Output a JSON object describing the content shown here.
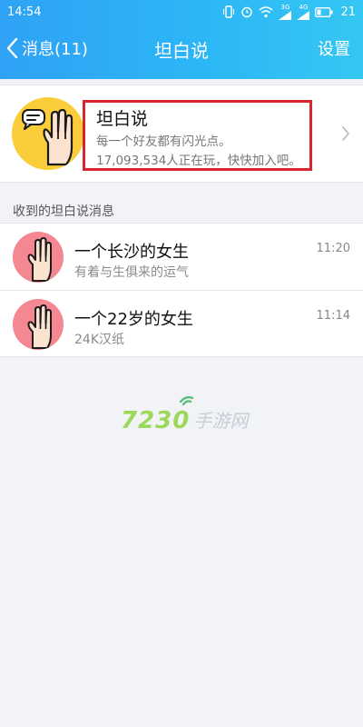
{
  "status_bar": {
    "time": "14:54",
    "battery": "21",
    "signal_labels": [
      "3G",
      "4G"
    ]
  },
  "nav": {
    "back_label": "消息(11)",
    "title": "坦白说",
    "settings_label": "设置"
  },
  "feature": {
    "title": "坦白说",
    "subtitle": "每一个好友都有闪光点。",
    "count_text": "17,093,534人正在玩，快快加入吧。"
  },
  "section": {
    "label": "收到的坦白说消息"
  },
  "messages": [
    {
      "title": "一个长沙的女生",
      "subtitle": "有着与生俱来的运气",
      "time": "11:20"
    },
    {
      "title": "一个22岁的女生",
      "subtitle": "24K汉纸",
      "time": "11:14"
    }
  ],
  "watermark": {
    "number": "7230",
    "text": "手游网"
  },
  "colors": {
    "header_start": "#2fa2f5",
    "header_end": "#35c7f3",
    "feature_logo_bg": "#fbcd3a",
    "avatar_bg": "#f48791",
    "highlight_border": "#d8262e"
  }
}
